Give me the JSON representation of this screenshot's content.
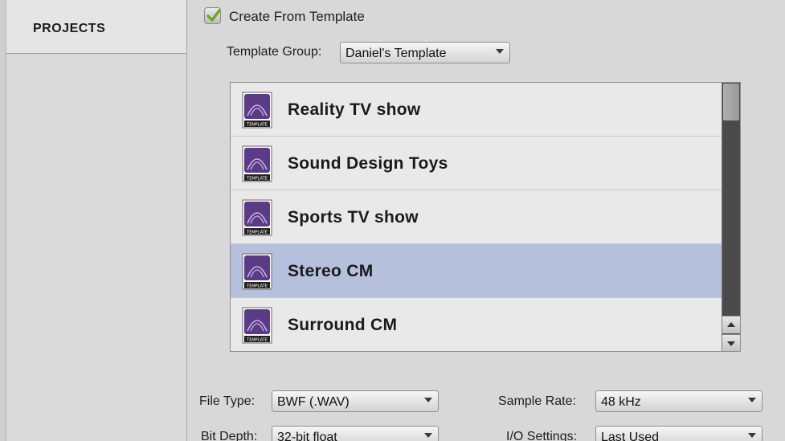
{
  "sidebar": {
    "title": "PROJECTS"
  },
  "template": {
    "checkbox_label": "Create From Template",
    "checked": true,
    "group_label": "Template Group:",
    "group_value": "Daniel's Template",
    "icon_caption": "TEMPLATE",
    "items": [
      {
        "name": "Reality TV show",
        "selected": false
      },
      {
        "name": "Sound Design Toys",
        "selected": false
      },
      {
        "name": "Sports TV show",
        "selected": false
      },
      {
        "name": "Stereo CM",
        "selected": true
      },
      {
        "name": "Surround CM",
        "selected": false
      }
    ]
  },
  "settings": {
    "file_type_label": "File Type:",
    "file_type_value": "BWF (.WAV)",
    "sample_rate_label": "Sample Rate:",
    "sample_rate_value": "48 kHz",
    "bit_depth_label": "Bit Depth:",
    "bit_depth_value": "32-bit float",
    "io_label": "I/O Settings:",
    "io_value": "Last Used"
  },
  "colors": {
    "selection": "#b4c0dc",
    "check": "#6aa820",
    "icon_purple": "#5b3a86"
  }
}
